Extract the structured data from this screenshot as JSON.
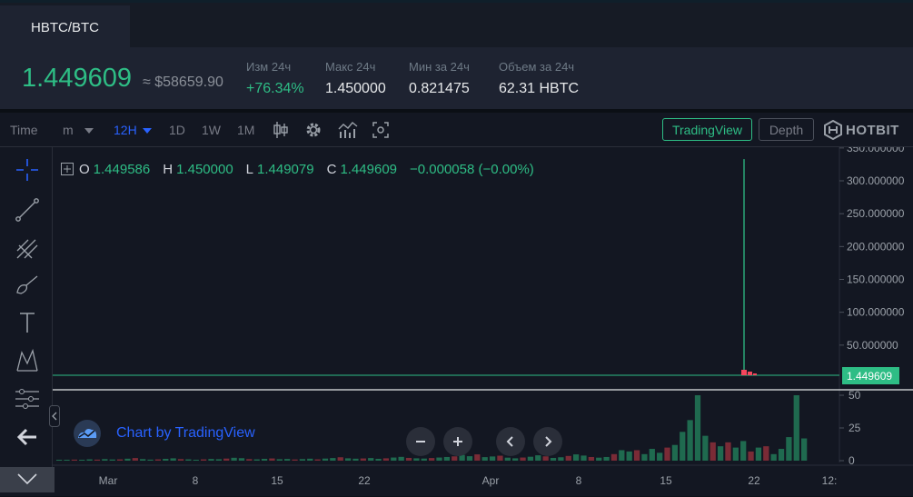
{
  "tabs": {
    "pair": "HBTC/BTC"
  },
  "ticker": {
    "last_price": "1.449609",
    "fiat_price": "≈ $58659.90",
    "stats": [
      {
        "label": "Изм 24ч",
        "value": "+76.34%"
      },
      {
        "label": "Макс 24ч",
        "value": "1.450000"
      },
      {
        "label": "Мин за 24ч",
        "value": "0.821475"
      },
      {
        "label": "Объем за 24ч",
        "value": "62.31 HBTC"
      }
    ]
  },
  "toolbar": {
    "time_label": "Time",
    "minute_label": "m",
    "active_interval": "12H",
    "intervals": [
      "1D",
      "1W",
      "1M"
    ],
    "tradingview_label": "TradingView",
    "depth_label": "Depth",
    "brand": "HOTBIT"
  },
  "legend": {
    "o_key": "O",
    "o_val": "1.449586",
    "h_key": "H",
    "h_val": "1.450000",
    "l_key": "L",
    "l_val": "1.449079",
    "c_key": "C",
    "c_val": "1.449609",
    "change": "−0.000058 (−0.00%)"
  },
  "attribution": "Chart by TradingView",
  "colors": {
    "up": "#2ebd85",
    "down": "#f6465d",
    "accent": "#2962ff",
    "bg": "#131722"
  },
  "icons": [
    "crosshair-icon",
    "trend-line-icon",
    "pitchfork-icon",
    "brush-icon",
    "text-tool-icon",
    "pattern-icon",
    "measure-icon",
    "back-arrow-icon",
    "candles-icon",
    "gear-icon",
    "indicators-icon",
    "screenshot-icon",
    "hotbit-logo-icon"
  ],
  "chart_data": {
    "type": "candlestick",
    "price_axis": {
      "ticks": [
        50,
        100,
        150,
        200,
        250,
        300,
        350
      ],
      "tick_labels": [
        "50.000000",
        "100.000000",
        "150.000000",
        "200.000000",
        "250.000000",
        "300.000000",
        "350.000000"
      ],
      "last_price_label": "1.449609",
      "ylim": [
        0,
        350
      ]
    },
    "volume_axis": {
      "ticks": [
        0,
        25,
        50
      ],
      "ylim": [
        0,
        50
      ]
    },
    "x_tick_labels": [
      "Mar",
      "8",
      "15",
      "22",
      "Apr",
      "8",
      "15",
      "22",
      "12:"
    ],
    "spike": {
      "date": "Apr 20",
      "high": 333
    },
    "volume_bars": [
      {
        "v": 0.5,
        "up": true
      },
      {
        "v": 0.6,
        "up": true
      },
      {
        "v": 0.8,
        "up": false
      },
      {
        "v": 0.7,
        "up": true
      },
      {
        "v": 1,
        "up": true
      },
      {
        "v": 0.8,
        "up": false
      },
      {
        "v": 1.2,
        "up": true
      },
      {
        "v": 0.9,
        "up": true
      },
      {
        "v": 1,
        "up": false
      },
      {
        "v": 1.5,
        "up": true
      },
      {
        "v": 2,
        "up": false
      },
      {
        "v": 1.2,
        "up": true
      },
      {
        "v": 0.8,
        "up": true
      },
      {
        "v": 1,
        "up": false
      },
      {
        "v": 1.4,
        "up": true
      },
      {
        "v": 1.8,
        "up": true
      },
      {
        "v": 1.2,
        "up": false
      },
      {
        "v": 1,
        "up": true
      },
      {
        "v": 0.7,
        "up": true
      },
      {
        "v": 1,
        "up": false
      },
      {
        "v": 1.3,
        "up": true
      },
      {
        "v": 1.1,
        "up": true
      },
      {
        "v": 1.6,
        "up": false
      },
      {
        "v": 2.2,
        "up": true
      },
      {
        "v": 1.9,
        "up": true
      },
      {
        "v": 1.2,
        "up": false
      },
      {
        "v": 1,
        "up": true
      },
      {
        "v": 1.4,
        "up": true
      },
      {
        "v": 1.7,
        "up": false
      },
      {
        "v": 1.1,
        "up": true
      },
      {
        "v": 1.3,
        "up": true
      },
      {
        "v": 0.9,
        "up": false
      },
      {
        "v": 1.2,
        "up": true
      },
      {
        "v": 1.5,
        "up": true
      },
      {
        "v": 1,
        "up": false
      },
      {
        "v": 1.6,
        "up": true
      },
      {
        "v": 2,
        "up": true
      },
      {
        "v": 2.6,
        "up": false
      },
      {
        "v": 1.8,
        "up": true
      },
      {
        "v": 1.5,
        "up": true
      },
      {
        "v": 1.7,
        "up": false
      },
      {
        "v": 2,
        "up": true
      },
      {
        "v": 1.4,
        "up": true
      },
      {
        "v": 1.8,
        "up": false
      },
      {
        "v": 2.4,
        "up": true
      },
      {
        "v": 2.9,
        "up": true
      },
      {
        "v": 2.1,
        "up": false
      },
      {
        "v": 1.8,
        "up": true
      },
      {
        "v": 1.6,
        "up": true
      },
      {
        "v": 2,
        "up": false
      },
      {
        "v": 2.4,
        "up": true
      },
      {
        "v": 2.8,
        "up": true
      },
      {
        "v": 3.3,
        "up": false
      },
      {
        "v": 4.4,
        "up": true
      },
      {
        "v": 3.4,
        "up": true
      },
      {
        "v": 4.8,
        "up": false
      },
      {
        "v": 2.7,
        "up": true
      },
      {
        "v": 3.2,
        "up": true
      },
      {
        "v": 3.8,
        "up": false
      },
      {
        "v": 2.3,
        "up": true
      },
      {
        "v": 1.8,
        "up": true
      },
      {
        "v": 2.4,
        "up": false
      },
      {
        "v": 3,
        "up": true
      },
      {
        "v": 4.1,
        "up": true
      },
      {
        "v": 3.3,
        "up": false
      },
      {
        "v": 2.1,
        "up": true
      },
      {
        "v": 2.6,
        "up": true
      },
      {
        "v": 3.6,
        "up": false
      },
      {
        "v": 4.8,
        "up": true
      },
      {
        "v": 3.9,
        "up": true
      },
      {
        "v": 2.8,
        "up": false
      },
      {
        "v": 2.3,
        "up": true
      },
      {
        "v": 2.8,
        "up": true
      },
      {
        "v": 5,
        "up": false
      },
      {
        "v": 8,
        "up": true
      },
      {
        "v": 7,
        "up": true
      },
      {
        "v": 8,
        "up": false
      },
      {
        "v": 5,
        "up": true
      },
      {
        "v": 9,
        "up": true
      },
      {
        "v": 6,
        "up": true
      },
      {
        "v": 10,
        "up": false
      },
      {
        "v": 12,
        "up": true
      },
      {
        "v": 22,
        "up": true
      },
      {
        "v": 31,
        "up": true
      },
      {
        "v": 50,
        "up": true
      },
      {
        "v": 19,
        "up": true
      },
      {
        "v": 14,
        "up": false
      },
      {
        "v": 11,
        "up": true
      },
      {
        "v": 14,
        "up": false
      },
      {
        "v": 10,
        "up": true
      },
      {
        "v": 15,
        "up": true
      },
      {
        "v": 7,
        "up": false
      },
      {
        "v": 10,
        "up": true
      },
      {
        "v": 11,
        "up": false
      },
      {
        "v": 5,
        "up": true
      },
      {
        "v": 9,
        "up": true
      },
      {
        "v": 18,
        "up": true
      },
      {
        "v": 50,
        "up": true
      },
      {
        "v": 17,
        "up": true
      }
    ]
  }
}
